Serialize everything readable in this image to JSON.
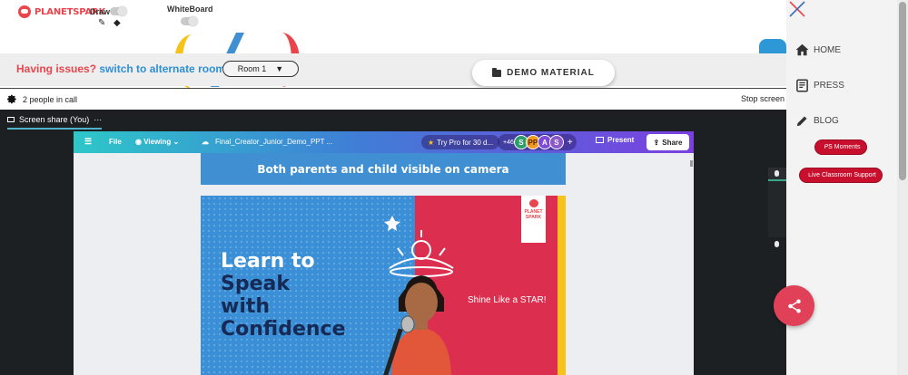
{
  "toolbar": {
    "logo_text": "PLANETSPARK",
    "draw_label": "Draw",
    "whiteboard_label": "WhiteBoard",
    "draw_icons": [
      "pencil-icon",
      "eraser-icon"
    ]
  },
  "issue_bar": {
    "issue_text": "Having issues?",
    "link_text": "switch to alternate room",
    "room_value": "Room 1",
    "room_caret": "▼"
  },
  "demo_material": {
    "label": "DEMO MATERIAL"
  },
  "call": {
    "people_count": "2 people in call",
    "stop_share": "Stop screen",
    "screen_share_tab": "Screen share (You)",
    "tab_menu": "···"
  },
  "canva": {
    "menu_icon": "☰",
    "file": "File",
    "viewing": "Viewing",
    "doc_title": "Final_Creator_Junior_Demo_PPT ...",
    "try_pro": "Try Pro for 30 d...",
    "collab_count": "+46",
    "avatars": [
      {
        "letter": "S",
        "color": "#2e9e6b"
      },
      {
        "letter": "PP",
        "color": "#f29a1f"
      },
      {
        "letter": "A",
        "color": "#7f4bd6"
      },
      {
        "letter": "S",
        "color": "#8a58c9"
      }
    ],
    "add": "+",
    "present": "Present",
    "share": "Share"
  },
  "slides": {
    "banner": "Both parents and child visible on camera",
    "headline_line1": "Learn to",
    "headline_line2": "Speak",
    "headline_line3": "with",
    "headline_line4": "Confidence",
    "tagline": "Shine Like a STAR!",
    "brand_tag": "PLANET SPARK"
  },
  "sidebar": {
    "home": "HOME",
    "press": "PRESS",
    "blog": "BLOG",
    "ps_moments": "PS Moments",
    "live_support": "Live Classroom Support"
  },
  "colors": {
    "brand_red": "#e8454c",
    "link_blue": "#2f8fd5",
    "pill_red": "#c8102e",
    "fab_pink": "#e04158"
  }
}
